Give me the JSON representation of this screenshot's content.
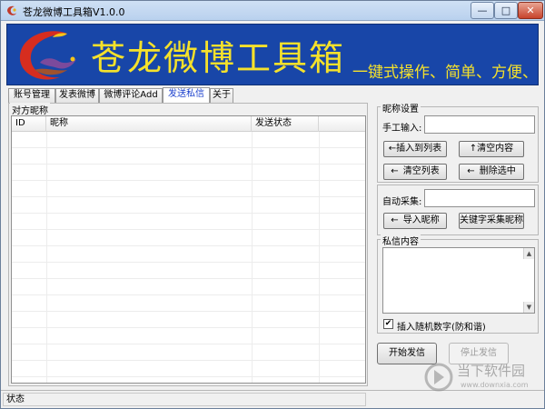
{
  "window": {
    "title": "苍龙微博工具箱V1.0.0",
    "controls": {
      "minimize": "—",
      "maximize": "□",
      "close": "✕"
    }
  },
  "banner": {
    "title": "苍龙微博工具箱",
    "slogan": "一键式操作、简单、方便、高效",
    "text_color": "#f5e12b",
    "background": "#1846a8"
  },
  "tabs": [
    {
      "label": "账号管理"
    },
    {
      "label": "发表微博"
    },
    {
      "label": "微博评论Add"
    },
    {
      "label": "发送私信",
      "active": true
    },
    {
      "label": "关于"
    }
  ],
  "left": {
    "group_label": "对方昵称",
    "columns": [
      "ID",
      "昵称",
      "发送状态"
    ]
  },
  "right": {
    "nick_settings": {
      "label": "昵称设置",
      "manual_input_label": "手工输入:",
      "manual_input_value": "",
      "insert_button": "←插入到列表",
      "clear_content_button": "↑清空内容",
      "clear_list_button": "清空列表",
      "delete_selected_button": "删除选中",
      "auto_collect_label": "自动采集:",
      "auto_collect_value": "",
      "import_button": "导入昵称",
      "keyword_collect_button": "关键字采集昵称"
    },
    "message": {
      "label": "私信内容",
      "value": "",
      "random_digits_label": "插入随机数字(防和谐)",
      "random_digits_checked": true
    },
    "start_button": "开始发信",
    "stop_button": "停止发信"
  },
  "status": {
    "text": "状态"
  },
  "watermark": {
    "name": "当下软件园",
    "url": "www.downxia.com"
  },
  "icons": {
    "app": "dragon-logo-icon",
    "arrow_left": "arrow-left-icon",
    "arrow_up": "arrow-up-icon"
  }
}
